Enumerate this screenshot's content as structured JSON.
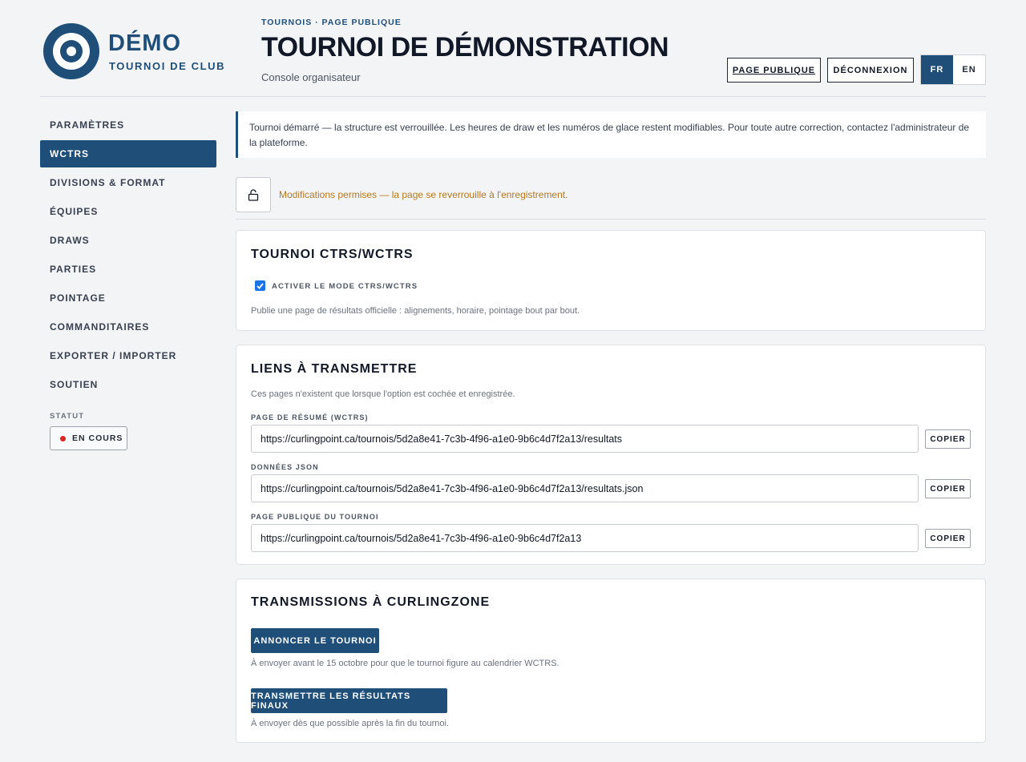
{
  "brand": {
    "name": "DÉMO",
    "subtitle": "TOURNOI DE CLUB"
  },
  "header": {
    "eyebrow": "TOURNOIS · PAGE PUBLIQUE",
    "title": "TOURNOI DE DÉMONSTRATION",
    "subtitle": "Console organisateur",
    "public_page": "PAGE PUBLIQUE",
    "logout": "DÉCONNEXION",
    "lang_fr": "FR",
    "lang_en": "EN"
  },
  "sidebar": {
    "items": [
      {
        "label": "PARAMÈTRES"
      },
      {
        "label": "WCTRS"
      },
      {
        "label": "DIVISIONS & FORMAT"
      },
      {
        "label": "ÉQUIPES"
      },
      {
        "label": "DRAWS"
      },
      {
        "label": "PARTIES"
      },
      {
        "label": "POINTAGE"
      },
      {
        "label": "COMMANDITAIRES"
      },
      {
        "label": "EXPORTER / IMPORTER"
      },
      {
        "label": "SOUTIEN"
      }
    ],
    "active_index": 1,
    "status_label": "STATUT",
    "status_value": "EN COURS",
    "status_color": "#dc2626"
  },
  "notice": "Tournoi démarré — la structure est verrouillée. Les heures de draw et les numéros de glace restent modifiables. Pour toute autre correction, contactez l'administrateur de la plateforme.",
  "lock": {
    "icon": "unlock-icon",
    "message": "Modifications permises — la page se reverrouille à l'enregistrement."
  },
  "wctrs": {
    "title": "TOURNOI CTRS/WCTRS",
    "checkbox_label": "ACTIVER LE MODE CTRS/WCTRS",
    "checked": true,
    "help": "Publie une page de résultats officielle : alignements, horaire, pointage bout par bout."
  },
  "links": {
    "title": "LIENS À TRANSMETTRE",
    "help": "Ces pages n'existent que lorsque l'option est cochée et enregistrée.",
    "items": [
      {
        "label": "PAGE DE RÉSUMÉ (WCTRS)",
        "url": "https://curlingpoint.ca/tournois/5d2a8e41-7c3b-4f96-a1e0-9b6c4d7f2a13/resultats",
        "copy": "COPIER"
      },
      {
        "label": "DONNÉES JSON",
        "url": "https://curlingpoint.ca/tournois/5d2a8e41-7c3b-4f96-a1e0-9b6c4d7f2a13/resultats.json",
        "copy": "COPIER"
      },
      {
        "label": "PAGE PUBLIQUE DU TOURNOI",
        "url": "https://curlingpoint.ca/tournois/5d2a8e41-7c3b-4f96-a1e0-9b6c4d7f2a13",
        "copy": "COPIER"
      }
    ]
  },
  "curlingzone": {
    "title": "TRANSMISSIONS À CURLINGZONE",
    "announce": "ANNONCER LE TOURNOI",
    "announce_help": "À envoyer avant le 15 octobre pour que le tournoi figure au calendrier WCTRS.",
    "final": "TRANSMETTRE LES RÉSULTATS FINAUX",
    "final_help": "À envoyer dès que possible après la fin du tournoi."
  },
  "colors": {
    "accent": "#1f4e79",
    "warning": "#b7791f",
    "background": "#f3f4f6"
  }
}
